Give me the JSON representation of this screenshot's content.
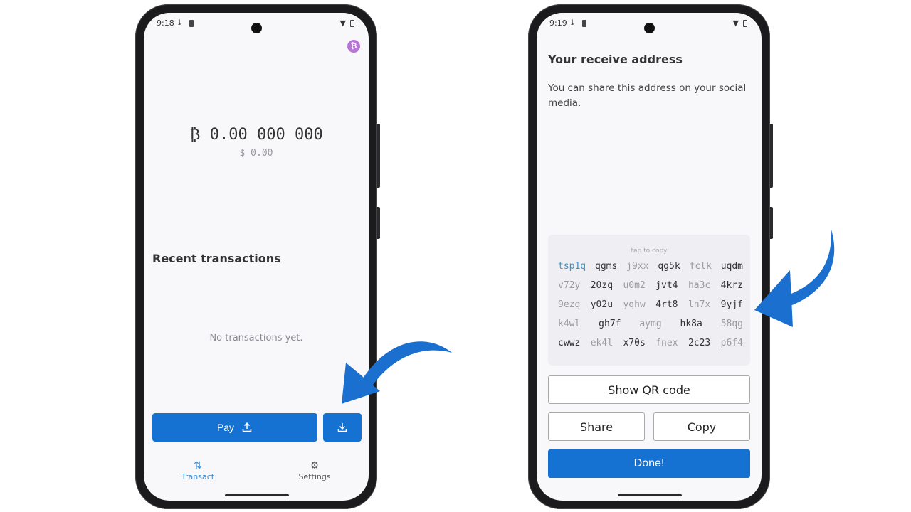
{
  "left_phone": {
    "status": {
      "time": "9:18"
    },
    "currency_badge": "₿",
    "balance": "₿ 0.00 000 000",
    "fiat_balance": "$ 0.00",
    "recent_title": "Recent transactions",
    "empty_text": "No transactions yet.",
    "pay_label": "Pay",
    "nav": [
      {
        "label": "Transact",
        "icon": "swap-arrows-icon"
      },
      {
        "label": "Settings",
        "icon": "gear-icon"
      }
    ]
  },
  "right_phone": {
    "status": {
      "time": "9:19"
    },
    "title": "Your receive address",
    "description": "You can share this address on your social media.",
    "tap_hint": "tap to copy",
    "address_words": [
      "tsp1q",
      "qgms",
      "j9xx",
      "qg5k",
      "fclk",
      "uqdm",
      "v72y",
      "20zq",
      "u0m2",
      "jvt4",
      "ha3c",
      "4krz",
      "9ezg",
      "y02u",
      "yqhw",
      "4rt8",
      "ln7x",
      "9yjf",
      "k4wl",
      "gh7f",
      "aymg",
      "hk8a",
      "58qg",
      "cwwz",
      "ek4l",
      "x70s",
      "fnex",
      "2c23",
      "p6f4"
    ],
    "show_qr_label": "Show QR code",
    "share_label": "Share",
    "copy_label": "Copy",
    "done_label": "Done!"
  },
  "colors": {
    "accent": "#1572d3",
    "highlight": "#2a9bd6",
    "badge": "#b874d6",
    "arrow": "#1a6fcf"
  }
}
